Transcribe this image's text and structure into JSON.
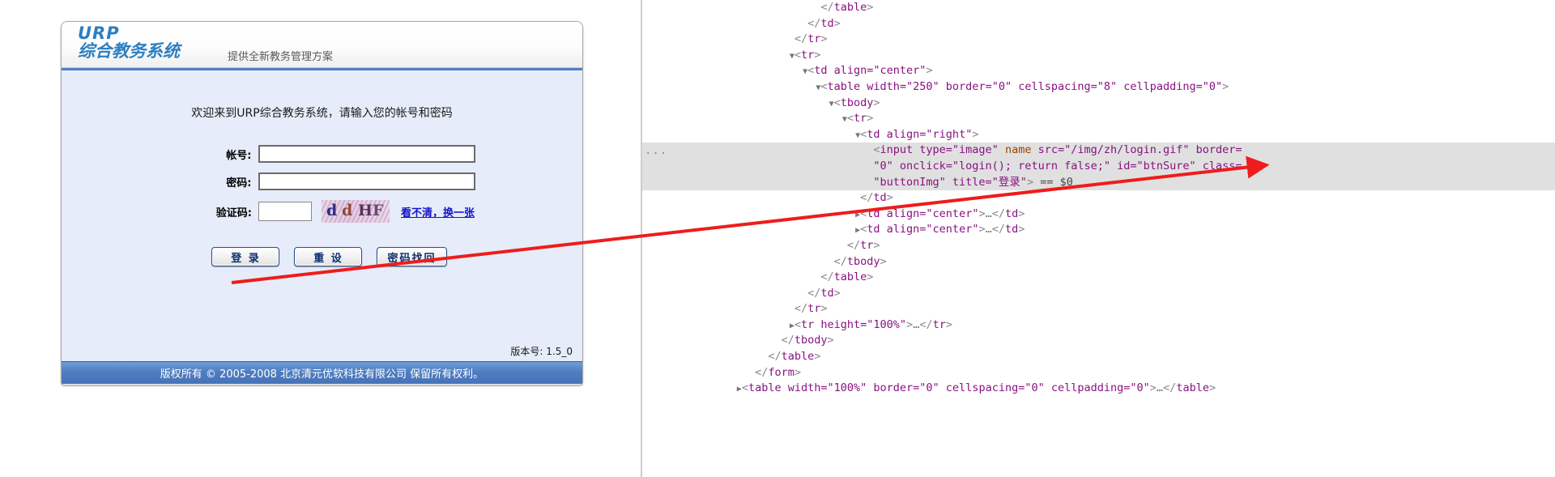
{
  "login": {
    "brand_title": "URP",
    "brand_title_cn": "综合教务系统",
    "brand_subtitle": "提供全新教务管理方案",
    "welcome": "欢迎来到URP综合教务系统，请输入您的帐号和密码",
    "fields": [
      {
        "label": "帐号:",
        "value": "",
        "placeholder": ""
      },
      {
        "label": "密码:",
        "value": "",
        "placeholder": ""
      },
      {
        "label": "验证码:",
        "value": "",
        "placeholder": ""
      }
    ],
    "captcha_chars": [
      "d",
      "d",
      "H",
      "F"
    ],
    "refresh_link": "看不清，换一张",
    "buttons": [
      {
        "label": "登 录"
      },
      {
        "label": "重 设"
      },
      {
        "label": "密码找回"
      }
    ],
    "version": "版本号: 1.5_0",
    "footer": "版权所有 © 2005-2008 北京清元优软科技有限公司 保留所有权利。"
  },
  "devtools": {
    "overflow_dots": "...",
    "lines": [
      {
        "indent": 13,
        "tri": "",
        "text": "</table>"
      },
      {
        "indent": 12,
        "tri": "",
        "text": "</td>"
      },
      {
        "indent": 11,
        "tri": "",
        "text": "</tr>"
      },
      {
        "indent": 11,
        "tri": "▼",
        "text": "<tr>"
      },
      {
        "indent": 12,
        "tri": "▼",
        "text": "<td align=\"center\">"
      },
      {
        "indent": 13,
        "tri": "▼",
        "text": "<table width=\"250\" border=\"0\" cellspacing=\"8\" cellpadding=\"0\">"
      },
      {
        "indent": 14,
        "tri": "▼",
        "text": "<tbody>"
      },
      {
        "indent": 15,
        "tri": "▼",
        "text": "<tr>"
      },
      {
        "indent": 16,
        "tri": "▼",
        "text": "<td align=\"right\">"
      },
      {
        "indent": 17,
        "tri": "",
        "text": "<input type=\"image\" name src=\"/img/zh/login.gif\" border="
      },
      {
        "indent": 17,
        "tri": "",
        "text": "\"0\" onclick=\"login(); return false;\" id=\"btnSure\" class="
      },
      {
        "indent": 17,
        "tri": "",
        "text": "\"buttonImg\" title=\"登录\"> == $0"
      },
      {
        "indent": 16,
        "tri": "",
        "text": "</td>"
      },
      {
        "indent": 16,
        "tri": "▶",
        "text": "<td align=\"center\">…</td>"
      },
      {
        "indent": 16,
        "tri": "▶",
        "text": "<td align=\"center\">…</td>"
      },
      {
        "indent": 15,
        "tri": "",
        "text": "</tr>"
      },
      {
        "indent": 14,
        "tri": "",
        "text": "</tbody>"
      },
      {
        "indent": 13,
        "tri": "",
        "text": "</table>"
      },
      {
        "indent": 12,
        "tri": "",
        "text": "</td>"
      },
      {
        "indent": 11,
        "tri": "",
        "text": "</tr>"
      },
      {
        "indent": 11,
        "tri": "▶",
        "text": "<tr height=\"100%\">…</tr>"
      },
      {
        "indent": 10,
        "tri": "",
        "text": "</tbody>"
      },
      {
        "indent": 9,
        "tri": "",
        "text": "</table>"
      },
      {
        "indent": 8,
        "tri": "",
        "text": "</form>"
      },
      {
        "indent": 7,
        "tri": "▶",
        "text": "<table width=\"100%\" border=\"0\" cellspacing=\"0\" cellpadding=\"0\">…</table>"
      }
    ],
    "selected_line_indices": [
      9,
      10,
      11
    ],
    "annotation_color": "#ee1c1c"
  }
}
